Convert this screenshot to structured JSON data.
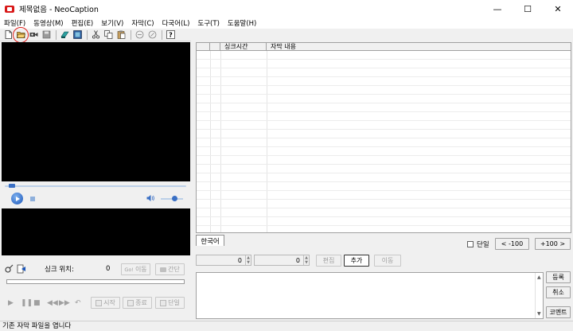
{
  "window": {
    "title": "제목없음 - NeoCaption",
    "minimize": "—",
    "maximize": "☐",
    "close": "✕"
  },
  "menu": [
    "파일(F)",
    "동영상(M)",
    "편집(E)",
    "보기(V)",
    "자막(C)",
    "다국어(L)",
    "도구(T)",
    "도움말(H)"
  ],
  "toolbar": {
    "icons": [
      "new-file-icon",
      "open-folder-icon",
      "open-video-icon",
      "save-icon",
      "save-as-icon",
      "properties-icon",
      "cut-icon",
      "copy-icon",
      "paste-icon",
      "undo-icon",
      "redo-icon",
      "help-icon"
    ],
    "highlighted": "open-folder-icon"
  },
  "player": {
    "sync_label": "싱크 위치:",
    "sync_value": "0",
    "go_button": "이동",
    "go_prefix": "Go!",
    "interval_button": "간단",
    "start_button": "시작",
    "end_button": "종료",
    "single_button": "단일"
  },
  "grid": {
    "headers": [
      "싱크시간",
      "자막 내용"
    ]
  },
  "language_tab": "한국어",
  "single_checkbox": "단일",
  "prev_button": "< -100",
  "next_button": "+100 >",
  "spin1_value": "0",
  "spin2_value": "0",
  "edit_button": "편집",
  "add_button": "추가",
  "move_button": "이동",
  "register_button": "등록",
  "cancel_button": "취소",
  "comment_button": "코멘트",
  "status": "기존 자막 파일을 엽니다"
}
